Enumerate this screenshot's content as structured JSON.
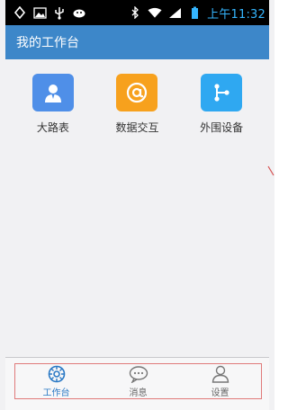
{
  "status_bar": {
    "time": "上午11:32",
    "time_color": "#35b6ff",
    "left_icons": [
      "sync-icon",
      "image-icon",
      "usb-icon",
      "android-icon"
    ],
    "right_icons": [
      "bluetooth-icon",
      "wifi-icon",
      "signal-icon",
      "battery-icon"
    ]
  },
  "header": {
    "title": "我的工作台",
    "background": "#3d87c9"
  },
  "apps": [
    {
      "label": "大路表",
      "icon": "person-icon",
      "color": "#4f8fe8"
    },
    {
      "label": "数据交互",
      "icon": "at-sign-icon",
      "color": "#f7a11d"
    },
    {
      "label": "外围设备",
      "icon": "tree-icon",
      "color": "#2fa8f1"
    }
  ],
  "bottom_nav": {
    "items": [
      {
        "label": "工作台",
        "icon": "workbench-icon",
        "active": true
      },
      {
        "label": "消息",
        "icon": "message-icon",
        "active": false
      },
      {
        "label": "设置",
        "icon": "user-icon",
        "active": false
      }
    ],
    "active_color": "#2a79c5",
    "outline_color": "#e07a7a"
  }
}
